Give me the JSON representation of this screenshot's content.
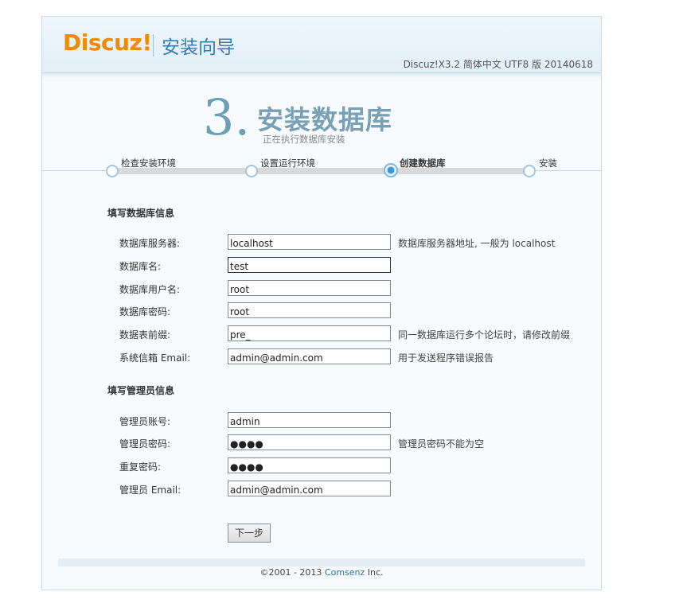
{
  "header": {
    "logo_text": "Discuz!",
    "wizard_title": "安装向导",
    "version": "Discuz!X3.2 简体中文 UTF8 版 20140618"
  },
  "step": {
    "number": "3.",
    "title": "安装数据库",
    "subtitle": "正在执行数据库安装"
  },
  "progress": {
    "steps": [
      {
        "label": "检查安装环境"
      },
      {
        "label": "设置运行环境"
      },
      {
        "label": "创建数据库"
      },
      {
        "label": "安装"
      }
    ],
    "current_index": 2
  },
  "db_section": {
    "title": "填写数据库信息",
    "fields": [
      {
        "label": "数据库服务器:",
        "value": "localhost",
        "hint": "数据库服务器地址, 一般为 localhost"
      },
      {
        "label": "数据库名:",
        "value": "test",
        "hint": ""
      },
      {
        "label": "数据库用户名:",
        "value": "root",
        "hint": ""
      },
      {
        "label": "数据库密码:",
        "value": "root",
        "hint": ""
      },
      {
        "label": "数据表前缀:",
        "value": "pre_",
        "hint": "同一数据库运行多个论坛时，请修改前缀"
      },
      {
        "label": "系统信箱 Email:",
        "value": "admin@admin.com",
        "hint": "用于发送程序错误报告"
      }
    ]
  },
  "admin_section": {
    "title": "填写管理员信息",
    "fields": [
      {
        "label": "管理员账号:",
        "value": "admin",
        "hint": ""
      },
      {
        "label": "管理员密码:",
        "value": "●●●●",
        "hint": "管理员密码不能为空"
      },
      {
        "label": "重复密码:",
        "value": "●●●●",
        "hint": ""
      },
      {
        "label": "管理员 Email:",
        "value": "admin@admin.com",
        "hint": ""
      }
    ]
  },
  "next_button": "下一步",
  "footer": {
    "copyright": "©2001 - 2013 ",
    "brand": "Comsenz",
    "suffix": " Inc."
  }
}
